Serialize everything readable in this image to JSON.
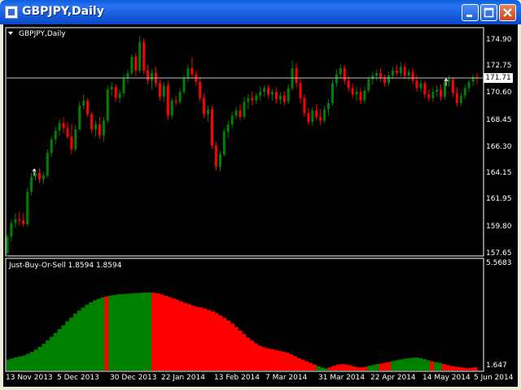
{
  "window": {
    "title": "GBPJPY,Daily",
    "buttons": [
      "minimize",
      "maximize",
      "close"
    ]
  },
  "main_chart": {
    "label": "GBPJPY,Daily",
    "current_price": "171.71",
    "price_axis": [
      "174.90",
      "172.75",
      "170.60",
      "168.45",
      "166.30",
      "164.15",
      "161.95",
      "159.80",
      "157.65"
    ]
  },
  "indicator": {
    "label": "Just-Buy-Or-Sell 1.8594 1.8594",
    "axis_top": "5.5683",
    "axis_bottom": "1.647"
  },
  "date_axis": [
    "13 Nov 2013",
    "5 Dec 2013",
    "30 Dec 2013",
    "22 Jan 2014",
    "13 Feb 2014",
    "7 Mar 2014",
    "31 Mar 2014",
    "22 Apr 2014",
    "14 May 2014",
    "5 Jun 2014"
  ],
  "colors": {
    "bull": "#008000",
    "bear": "#ff0000",
    "background": "#000000",
    "text": "#ffffff"
  },
  "chart_data": {
    "type": "candlestick",
    "title": "GBPJPY,Daily",
    "ylim": [
      157.65,
      174.9
    ],
    "current_price": 171.71,
    "candles": [
      [
        157.7,
        159.2,
        157.4,
        159.0
      ],
      [
        159.0,
        160.4,
        158.6,
        160.1
      ],
      [
        160.1,
        160.9,
        159.7,
        160.4
      ],
      [
        160.4,
        161.0,
        159.9,
        160.3
      ],
      [
        160.3,
        160.9,
        159.8,
        160.0
      ],
      [
        160.0,
        162.9,
        159.8,
        162.6
      ],
      [
        162.6,
        164.1,
        162.3,
        163.8
      ],
      [
        163.8,
        164.4,
        163.5,
        164.1
      ],
      [
        164.1,
        164.5,
        163.3,
        163.6
      ],
      [
        163.6,
        164.2,
        163.2,
        163.9
      ],
      [
        163.9,
        166.0,
        163.7,
        165.7
      ],
      [
        165.7,
        167.0,
        165.4,
        166.8
      ],
      [
        166.8,
        167.8,
        166.4,
        167.5
      ],
      [
        167.5,
        168.4,
        167.1,
        168.1
      ],
      [
        168.1,
        168.6,
        167.3,
        167.7
      ],
      [
        167.7,
        168.2,
        166.8,
        167.0
      ],
      [
        167.0,
        168.0,
        165.6,
        166.0
      ],
      [
        166.0,
        167.9,
        165.8,
        167.6
      ],
      [
        167.6,
        169.8,
        167.4,
        169.5
      ],
      [
        169.5,
        170.4,
        169.2,
        169.9
      ],
      [
        169.9,
        170.1,
        168.6,
        168.8
      ],
      [
        168.8,
        169.0,
        167.3,
        167.6
      ],
      [
        167.6,
        168.3,
        167.0,
        168.0
      ],
      [
        168.0,
        168.6,
        166.8,
        167.1
      ],
      [
        167.1,
        168.6,
        166.6,
        168.3
      ],
      [
        168.3,
        171.1,
        168.1,
        170.8
      ],
      [
        170.8,
        171.4,
        170.3,
        171.0
      ],
      [
        171.0,
        171.2,
        169.8,
        170.1
      ],
      [
        170.1,
        170.8,
        169.7,
        170.5
      ],
      [
        170.5,
        172.0,
        170.2,
        171.7
      ],
      [
        171.7,
        172.4,
        171.3,
        172.1
      ],
      [
        172.1,
        173.6,
        171.9,
        173.4
      ],
      [
        173.4,
        173.7,
        171.9,
        172.3
      ],
      [
        172.3,
        175.1,
        172.1,
        174.6
      ],
      [
        174.6,
        174.9,
        172.0,
        172.3
      ],
      [
        172.3,
        172.8,
        171.2,
        171.5
      ],
      [
        171.5,
        172.4,
        170.8,
        172.1
      ],
      [
        172.1,
        172.6,
        171.0,
        171.3
      ],
      [
        171.3,
        171.6,
        169.9,
        170.2
      ],
      [
        170.2,
        171.4,
        169.8,
        171.1
      ],
      [
        171.1,
        171.5,
        168.3,
        168.7
      ],
      [
        168.7,
        170.1,
        168.4,
        169.9
      ],
      [
        169.9,
        170.3,
        169.5,
        169.8
      ],
      [
        169.8,
        170.9,
        169.6,
        170.6
      ],
      [
        170.6,
        172.0,
        170.4,
        171.7
      ],
      [
        171.7,
        172.8,
        171.4,
        172.5
      ],
      [
        172.5,
        173.4,
        171.7,
        172.0
      ],
      [
        172.0,
        172.3,
        171.1,
        171.4
      ],
      [
        171.4,
        171.8,
        169.8,
        170.1
      ],
      [
        170.1,
        170.5,
        168.5,
        168.8
      ],
      [
        168.8,
        169.5,
        168.2,
        169.2
      ],
      [
        169.2,
        169.5,
        166.0,
        166.3
      ],
      [
        166.3,
        166.6,
        164.3,
        164.6
      ],
      [
        164.6,
        165.9,
        164.2,
        165.6
      ],
      [
        165.6,
        167.7,
        165.4,
        167.4
      ],
      [
        167.4,
        168.3,
        166.9,
        168.0
      ],
      [
        168.0,
        169.0,
        167.7,
        168.7
      ],
      [
        168.7,
        169.4,
        168.4,
        169.1
      ],
      [
        169.1,
        169.6,
        168.3,
        168.6
      ],
      [
        168.6,
        170.2,
        168.4,
        169.8
      ],
      [
        169.8,
        170.4,
        169.2,
        170.1
      ],
      [
        170.1,
        170.6,
        169.5,
        169.9
      ],
      [
        169.9,
        170.5,
        169.6,
        170.3
      ],
      [
        170.3,
        171.0,
        169.9,
        170.6
      ],
      [
        170.6,
        171.1,
        170.2,
        170.9
      ],
      [
        170.9,
        171.2,
        170.1,
        170.4
      ],
      [
        170.4,
        170.8,
        169.9,
        170.6
      ],
      [
        170.6,
        171.0,
        169.7,
        170.0
      ],
      [
        170.0,
        170.6,
        169.6,
        170.3
      ],
      [
        170.3,
        170.7,
        169.5,
        169.8
      ],
      [
        169.8,
        171.2,
        169.6,
        170.9
      ],
      [
        170.9,
        173.1,
        170.7,
        172.5
      ],
      [
        172.5,
        172.9,
        170.9,
        171.3
      ],
      [
        171.3,
        171.7,
        169.7,
        170.1
      ],
      [
        170.1,
        170.4,
        168.6,
        168.9
      ],
      [
        168.9,
        169.3,
        167.9,
        168.2
      ],
      [
        168.2,
        169.4,
        167.9,
        169.1
      ],
      [
        169.1,
        169.6,
        168.3,
        168.6
      ],
      [
        168.6,
        169.2,
        167.9,
        168.3
      ],
      [
        168.3,
        169.5,
        168.1,
        169.2
      ],
      [
        169.2,
        170.0,
        168.7,
        169.7
      ],
      [
        169.7,
        171.6,
        169.5,
        171.3
      ],
      [
        171.3,
        172.4,
        171.0,
        172.0
      ],
      [
        172.0,
        172.8,
        171.7,
        172.5
      ],
      [
        172.5,
        172.7,
        171.2,
        171.5
      ],
      [
        171.5,
        171.9,
        170.6,
        170.9
      ],
      [
        170.9,
        171.3,
        170.1,
        170.4
      ],
      [
        170.4,
        171.0,
        169.9,
        170.6
      ],
      [
        170.6,
        170.9,
        169.6,
        169.9
      ],
      [
        169.9,
        171.0,
        169.7,
        170.7
      ],
      [
        170.7,
        171.9,
        170.5,
        171.6
      ],
      [
        171.6,
        172.2,
        171.2,
        171.9
      ],
      [
        171.9,
        172.4,
        171.5,
        172.1
      ],
      [
        172.1,
        172.5,
        171.4,
        171.7
      ],
      [
        171.7,
        172.0,
        171.0,
        171.3
      ],
      [
        171.3,
        172.2,
        171.1,
        171.9
      ],
      [
        171.9,
        172.6,
        171.6,
        172.3
      ],
      [
        172.3,
        172.8,
        171.9,
        172.1
      ],
      [
        172.1,
        173.0,
        171.8,
        172.6
      ],
      [
        172.6,
        172.9,
        171.6,
        171.9
      ],
      [
        171.9,
        172.4,
        171.5,
        172.2
      ],
      [
        172.2,
        172.5,
        171.2,
        171.5
      ],
      [
        171.5,
        172.0,
        170.6,
        170.9
      ],
      [
        170.9,
        171.6,
        170.6,
        171.3
      ],
      [
        171.3,
        171.5,
        170.1,
        170.4
      ],
      [
        170.4,
        170.8,
        169.8,
        170.1
      ],
      [
        170.1,
        170.9,
        169.8,
        170.6
      ],
      [
        170.6,
        171.1,
        170.2,
        170.8
      ],
      [
        170.8,
        171.2,
        169.9,
        170.2
      ],
      [
        170.2,
        171.6,
        170.0,
        171.4
      ],
      [
        171.4,
        171.9,
        171.0,
        171.6
      ],
      [
        171.6,
        171.8,
        170.2,
        170.5
      ],
      [
        170.5,
        171.0,
        169.4,
        169.7
      ],
      [
        169.7,
        170.6,
        169.5,
        170.3
      ],
      [
        170.3,
        171.2,
        170.0,
        170.9
      ],
      [
        170.9,
        171.6,
        170.6,
        171.4
      ],
      [
        171.4,
        172.0,
        171.1,
        171.8
      ],
      [
        171.8,
        172.1,
        171.2,
        171.7
      ]
    ],
    "indicator": {
      "name": "Just-Buy-Or-Sell",
      "value": 1.8594,
      "ylim": [
        1.647,
        5.5683
      ],
      "values": [
        2.05,
        2.09,
        2.13,
        2.16,
        2.2,
        2.26,
        2.33,
        2.41,
        2.51,
        2.62,
        2.75,
        2.88,
        3.02,
        3.16,
        3.3,
        3.44,
        3.58,
        3.72,
        3.84,
        3.95,
        4.05,
        4.14,
        4.21,
        4.27,
        4.32,
        4.36,
        4.39,
        4.41,
        4.43,
        4.44,
        4.45,
        4.46,
        4.47,
        4.48,
        4.49,
        4.5,
        4.5,
        4.49,
        4.47,
        4.43,
        4.38,
        4.33,
        4.28,
        4.23,
        4.17,
        4.12,
        4.07,
        4.02,
        3.98,
        3.95,
        3.91,
        3.86,
        3.81,
        3.74,
        3.66,
        3.57,
        3.47,
        3.36,
        3.24,
        3.11,
        2.98,
        2.85,
        2.74,
        2.64,
        2.56,
        2.5,
        2.46,
        2.43,
        2.4,
        2.37,
        2.34,
        2.3,
        2.24,
        2.17,
        2.1,
        2.04,
        1.98,
        1.92,
        1.86,
        1.8,
        1.75,
        1.72,
        1.76,
        1.82,
        1.86,
        1.88,
        1.87,
        1.84,
        1.8,
        1.77,
        1.76,
        1.78,
        1.82,
        1.85,
        1.88,
        1.9,
        1.93,
        1.96,
        1.99,
        2.02,
        2.05,
        2.08,
        2.1,
        2.11,
        2.12,
        2.1,
        2.06,
        2.02,
        1.98,
        1.95,
        1.92,
        1.88,
        1.84,
        1.81,
        1.79,
        1.77,
        1.75,
        1.73,
        1.74,
        1.76
      ],
      "signal": [
        1,
        1,
        1,
        1,
        1,
        1,
        1,
        1,
        1,
        1,
        1,
        1,
        1,
        1,
        1,
        1,
        1,
        1,
        1,
        1,
        1,
        1,
        1,
        1,
        1,
        -1,
        1,
        1,
        1,
        1,
        1,
        1,
        1,
        1,
        1,
        1,
        1,
        -1,
        -1,
        -1,
        -1,
        -1,
        -1,
        -1,
        -1,
        -1,
        -1,
        -1,
        -1,
        -1,
        -1,
        -1,
        -1,
        -1,
        -1,
        -1,
        -1,
        -1,
        -1,
        -1,
        -1,
        -1,
        -1,
        -1,
        -1,
        -1,
        -1,
        -1,
        -1,
        -1,
        -1,
        -1,
        -1,
        -1,
        -1,
        -1,
        -1,
        -1,
        -1,
        1,
        1,
        1,
        -1,
        -1,
        -1,
        -1,
        -1,
        -1,
        -1,
        -1,
        -1,
        -1,
        1,
        1,
        1,
        -1,
        -1,
        -1,
        1,
        1,
        1,
        1,
        1,
        1,
        1,
        1,
        1,
        1,
        -1,
        1,
        1,
        -1,
        -1,
        -1,
        -1,
        -1,
        -1,
        -1,
        -1,
        -1,
        -1,
        -1,
        1
      ]
    },
    "dates": [
      "13 Nov 2013",
      "5 Dec 2013",
      "30 Dec 2013",
      "22 Jan 2014",
      "13 Feb 2014",
      "7 Mar 2014",
      "31 Mar 2014",
      "22 Apr 2014",
      "14 May 2014",
      "5 Jun 2014"
    ]
  }
}
